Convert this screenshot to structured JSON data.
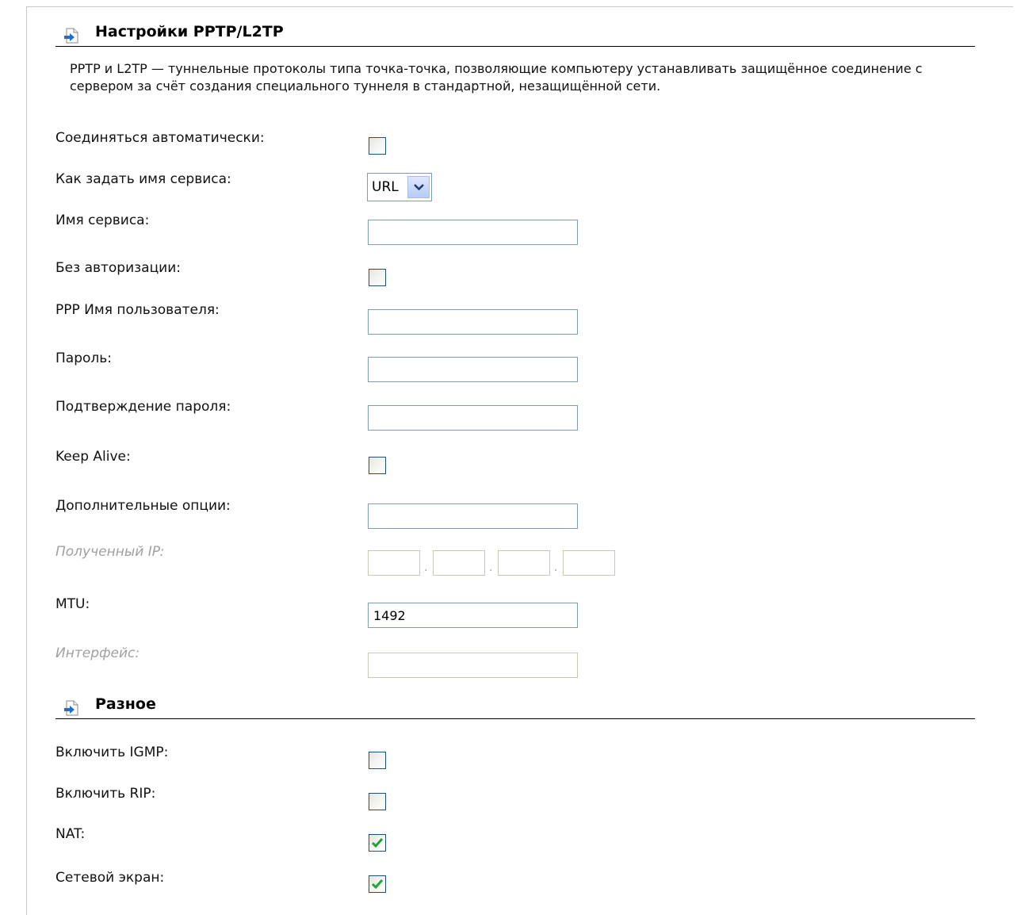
{
  "sections": [
    {
      "title": "Настройки PPTP/L2TP",
      "icon": "arrow-page-icon"
    },
    {
      "title": "Разное",
      "icon": "arrow-page-icon"
    }
  ],
  "description": "PPTP и L2TP — туннельные протоколы типа точка-точка, позволяющие компьютеру устанавливать защищённое соединение с сервером за счёт создания специального туннеля в стандартной, незащищённой сети.",
  "pptp": {
    "auto_connect": {
      "label": "Соединяться автоматически:",
      "checked": false
    },
    "service_name_mode": {
      "label": "Как задать имя сервиса:",
      "value": "URL"
    },
    "service_name": {
      "label": "Имя сервиса:",
      "value": ""
    },
    "no_auth": {
      "label": "Без авторизации:",
      "checked": false
    },
    "ppp_username": {
      "label": "PPP Имя пользователя:",
      "value": ""
    },
    "password": {
      "label": "Пароль:",
      "value": ""
    },
    "password_confirm": {
      "label": "Подтверждение пароля:",
      "value": ""
    },
    "keep_alive": {
      "label": "Keep Alive:",
      "checked": false
    },
    "extra_options": {
      "label": "Дополнительные опции:",
      "value": ""
    },
    "received_ip": {
      "label": "Полученный IP:",
      "octets": [
        "",
        "",
        "",
        ""
      ],
      "separator": "."
    },
    "mtu": {
      "label": "MTU:",
      "value": "1492"
    },
    "interface": {
      "label": "Интерфейс:",
      "value": ""
    }
  },
  "misc": {
    "igmp": {
      "label": "Включить IGMP:",
      "checked": false
    },
    "rip": {
      "label": "Включить RIP:",
      "checked": false
    },
    "nat": {
      "label": "NAT:",
      "checked": true
    },
    "firewall": {
      "label": "Сетевой экран:",
      "checked": true
    }
  },
  "colors": {
    "check": "#22a33a",
    "checkbox_border": "#1c5180",
    "input_border": "#7f9db9",
    "disabled_text": "#a0a0a0"
  }
}
